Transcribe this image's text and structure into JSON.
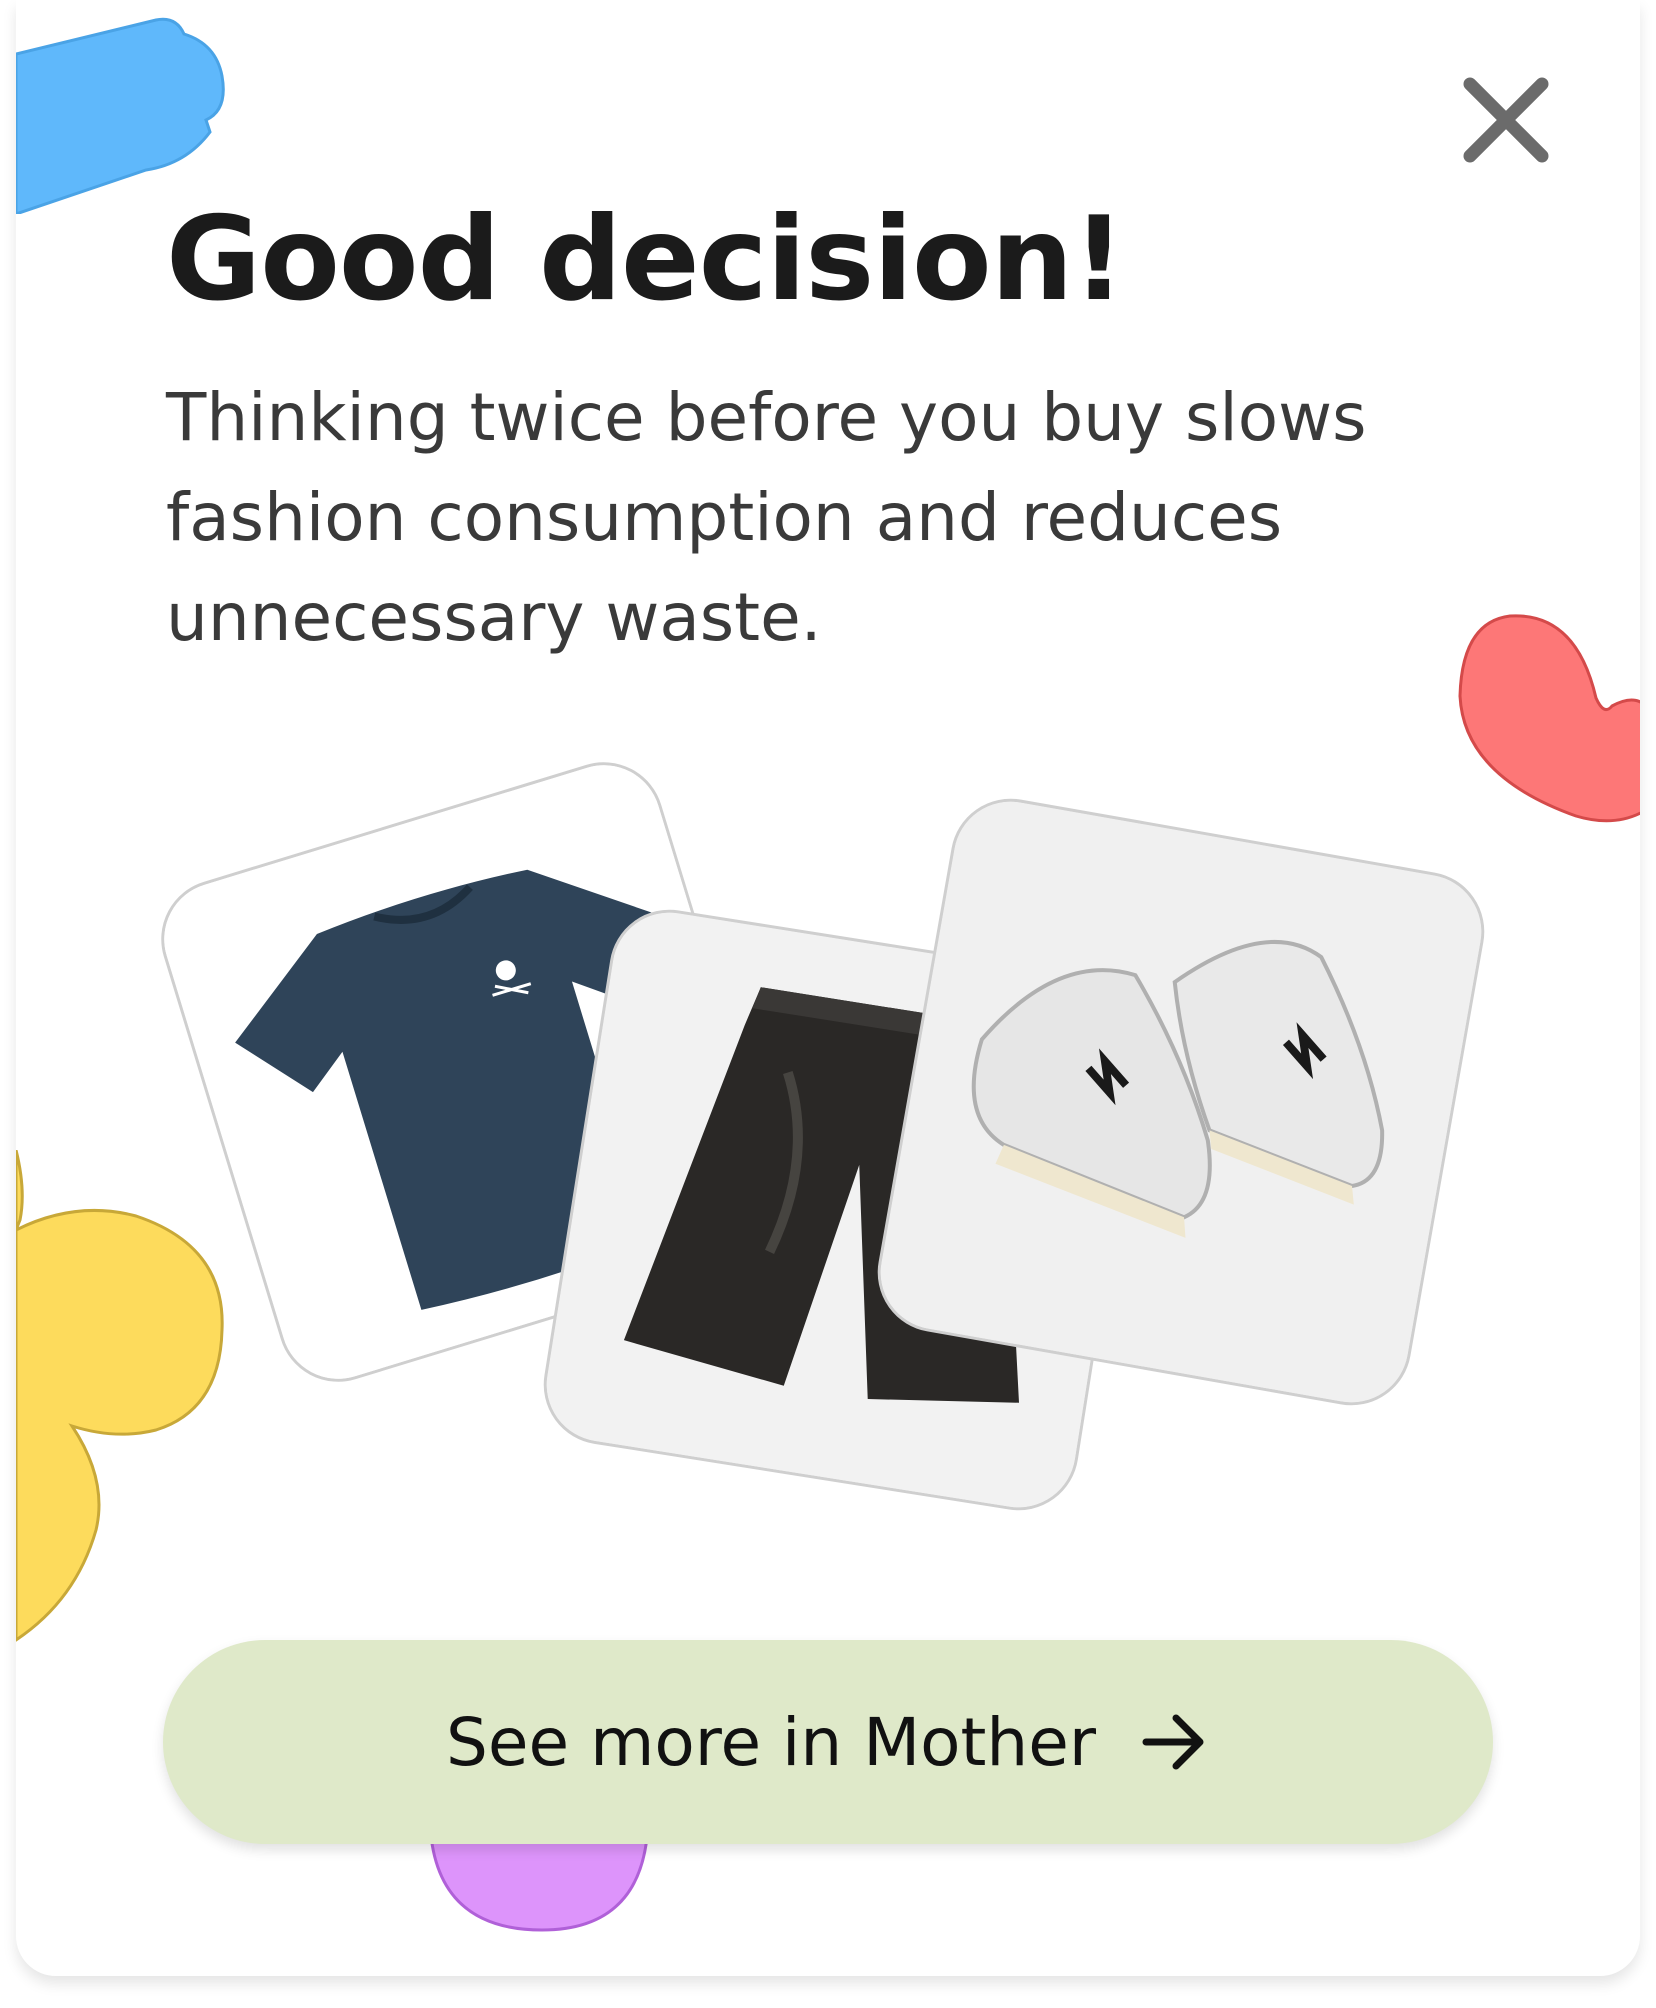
{
  "dialog": {
    "title": "Good decision!",
    "message": "Thinking twice before you buy slows fashion consumption and reduces unnecessary waste.",
    "close_icon": "close-icon",
    "cta": {
      "label": "See more in Mother",
      "icon": "arrow-right-icon"
    }
  },
  "products": [
    {
      "name": "tshirt",
      "icon": "tshirt-image"
    },
    {
      "name": "jorts",
      "icon": "denim-shorts-image"
    },
    {
      "name": "sneakers",
      "icon": "sneakers-image"
    }
  ],
  "colors": {
    "cta_background": "#dfe9c9",
    "blue_shape": "#5fb8fb",
    "red_shape": "#fd7777",
    "yellow_shape": "#fddb5c",
    "purple_shape": "#dd94fb"
  }
}
